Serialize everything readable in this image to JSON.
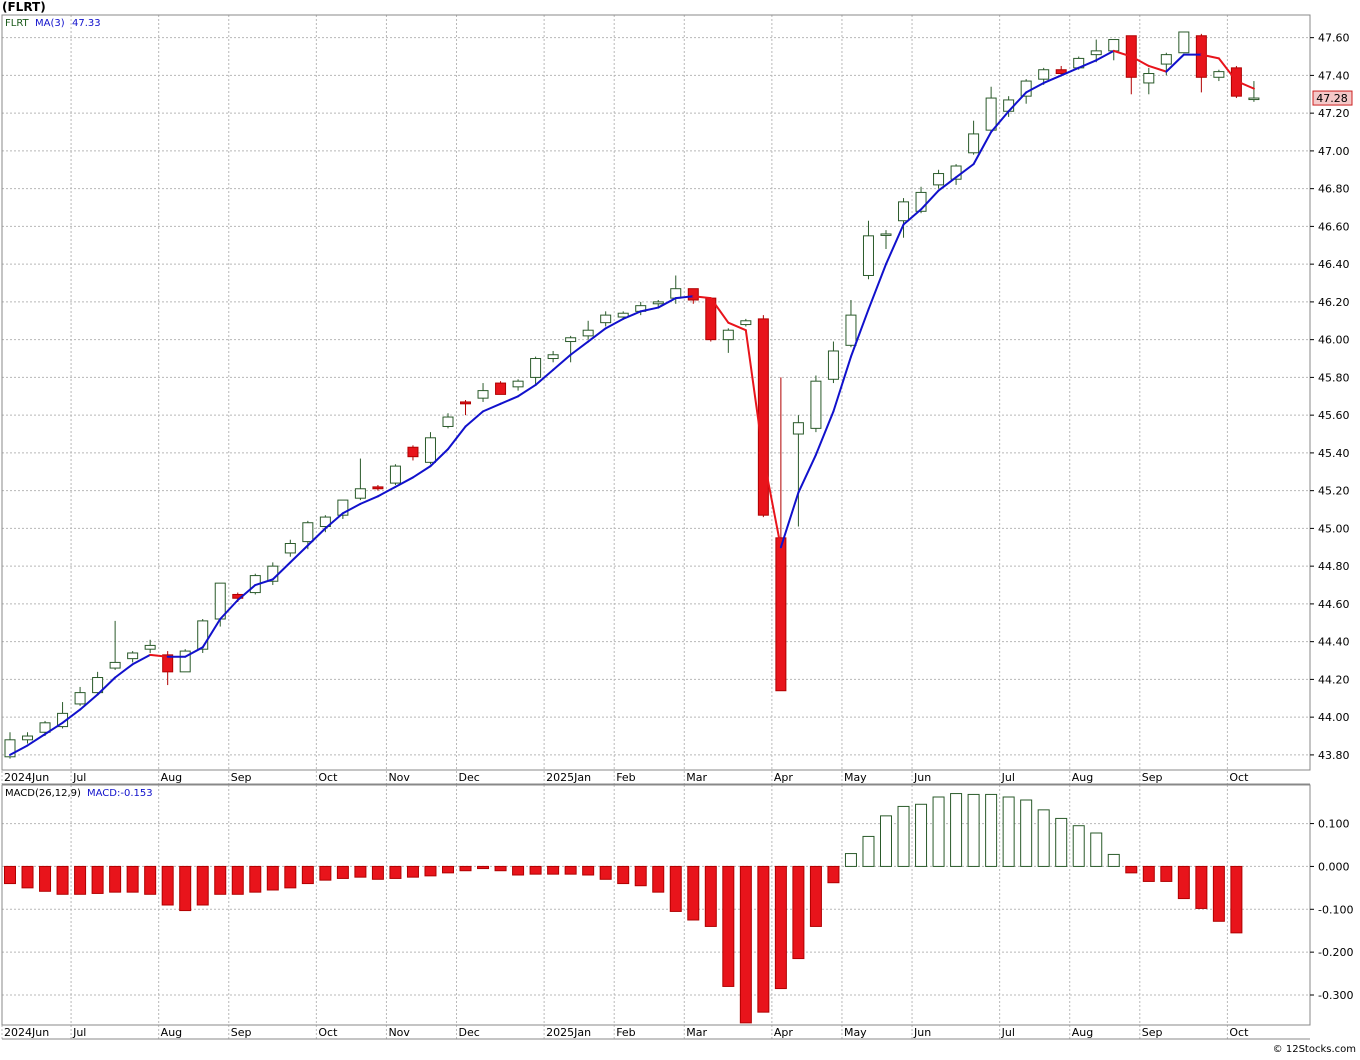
{
  "header": {
    "symbol_label": "(FLRT)"
  },
  "footer": {
    "credit": "© 12Stocks.com"
  },
  "colors": {
    "up_fill": "#ffffff",
    "up_stroke": "#2a5a2a",
    "down_fill": "#e8141b",
    "down_stroke": "#b00000",
    "ma_rising": "#1111cc",
    "ma_falling": "#e8141b",
    "grid": "#b8b8b8",
    "background": "#ffffff",
    "last_price_bg": "#f4c8c8",
    "last_price_border": "#cc2020"
  },
  "chart_data": [
    {
      "type": "candlestick",
      "panel": "price",
      "legend": {
        "symbol": "FLRT",
        "ma_label": "MA(3)",
        "ma_value": "47.33"
      },
      "last_price_label": "47.28",
      "ylim": [
        43.72,
        47.72
      ],
      "y_ticks": [
        "43.80",
        "44.00",
        "44.20",
        "44.40",
        "44.60",
        "44.80",
        "45.00",
        "45.20",
        "45.40",
        "45.60",
        "45.80",
        "46.00",
        "46.20",
        "46.40",
        "46.60",
        "46.80",
        "47.00",
        "47.20",
        "47.40",
        "47.60"
      ],
      "x_labels": [
        "2024Jun",
        "Jul",
        "Aug",
        "Sep",
        "Oct",
        "Nov",
        "Dec",
        "2025Jan",
        "Feb",
        "Mar",
        "Apr",
        "May",
        "Jun",
        "Jul",
        "Aug",
        "Sep",
        "Oct"
      ],
      "x_label_index": [
        0,
        4,
        9,
        13,
        18,
        22,
        26,
        31,
        35,
        39,
        44,
        48,
        52,
        57,
        61,
        65,
        70
      ],
      "candles": [
        {
          "o": 43.79,
          "h": 43.92,
          "l": 43.78,
          "c": 43.88
        },
        {
          "o": 43.88,
          "h": 43.92,
          "l": 43.86,
          "c": 43.9
        },
        {
          "o": 43.92,
          "h": 43.98,
          "l": 43.9,
          "c": 43.97
        },
        {
          "o": 43.95,
          "h": 44.08,
          "l": 43.94,
          "c": 44.02
        },
        {
          "o": 44.07,
          "h": 44.16,
          "l": 44.06,
          "c": 44.13
        },
        {
          "o": 44.13,
          "h": 44.24,
          "l": 44.12,
          "c": 44.21
        },
        {
          "o": 44.26,
          "h": 44.51,
          "l": 44.25,
          "c": 44.29
        },
        {
          "o": 44.31,
          "h": 44.35,
          "l": 44.29,
          "c": 44.34
        },
        {
          "o": 44.36,
          "h": 44.41,
          "l": 44.34,
          "c": 44.38
        },
        {
          "o": 44.33,
          "h": 44.35,
          "l": 44.17,
          "c": 44.24
        },
        {
          "o": 44.24,
          "h": 44.36,
          "l": 44.24,
          "c": 44.35
        },
        {
          "o": 44.36,
          "h": 44.52,
          "l": 44.34,
          "c": 44.51
        },
        {
          "o": 44.52,
          "h": 44.71,
          "l": 44.48,
          "c": 44.71
        },
        {
          "o": 44.65,
          "h": 44.66,
          "l": 44.61,
          "c": 44.63
        },
        {
          "o": 44.66,
          "h": 44.76,
          "l": 44.65,
          "c": 44.75
        },
        {
          "o": 44.72,
          "h": 44.82,
          "l": 44.7,
          "c": 44.8
        },
        {
          "o": 44.87,
          "h": 44.94,
          "l": 44.85,
          "c": 44.92
        },
        {
          "o": 44.93,
          "h": 45.04,
          "l": 44.89,
          "c": 45.03
        },
        {
          "o": 45.01,
          "h": 45.07,
          "l": 44.98,
          "c": 45.06
        },
        {
          "o": 45.07,
          "h": 45.15,
          "l": 45.05,
          "c": 45.15
        },
        {
          "o": 45.16,
          "h": 45.37,
          "l": 45.15,
          "c": 45.21
        },
        {
          "o": 45.22,
          "h": 45.23,
          "l": 45.2,
          "c": 45.21
        },
        {
          "o": 45.24,
          "h": 45.34,
          "l": 45.23,
          "c": 45.33
        },
        {
          "o": 45.43,
          "h": 45.44,
          "l": 45.36,
          "c": 45.38
        },
        {
          "o": 45.35,
          "h": 45.51,
          "l": 45.34,
          "c": 45.48
        },
        {
          "o": 45.54,
          "h": 45.61,
          "l": 45.53,
          "c": 45.59
        },
        {
          "o": 45.67,
          "h": 45.68,
          "l": 45.6,
          "c": 45.66
        },
        {
          "o": 45.69,
          "h": 45.77,
          "l": 45.67,
          "c": 45.73
        },
        {
          "o": 45.77,
          "h": 45.78,
          "l": 45.71,
          "c": 45.71
        },
        {
          "o": 45.75,
          "h": 45.79,
          "l": 45.73,
          "c": 45.78
        },
        {
          "o": 45.8,
          "h": 45.91,
          "l": 45.76,
          "c": 45.9
        },
        {
          "o": 45.9,
          "h": 45.94,
          "l": 45.88,
          "c": 45.92
        },
        {
          "o": 45.99,
          "h": 46.02,
          "l": 45.88,
          "c": 46.01
        },
        {
          "o": 46.02,
          "h": 46.1,
          "l": 46.0,
          "c": 46.05
        },
        {
          "o": 46.09,
          "h": 46.15,
          "l": 46.07,
          "c": 46.13
        },
        {
          "o": 46.12,
          "h": 46.15,
          "l": 46.11,
          "c": 46.14
        },
        {
          "o": 46.15,
          "h": 46.2,
          "l": 46.13,
          "c": 46.18
        },
        {
          "o": 46.19,
          "h": 46.21,
          "l": 46.17,
          "c": 46.2
        },
        {
          "o": 46.22,
          "h": 46.34,
          "l": 46.19,
          "c": 46.27
        },
        {
          "o": 46.27,
          "h": 46.27,
          "l": 46.19,
          "c": 46.21
        },
        {
          "o": 46.22,
          "h": 46.22,
          "l": 45.99,
          "c": 46.0
        },
        {
          "o": 46.0,
          "h": 46.06,
          "l": 45.93,
          "c": 46.05
        },
        {
          "o": 46.08,
          "h": 46.11,
          "l": 46.07,
          "c": 46.1
        },
        {
          "o": 46.11,
          "h": 46.13,
          "l": 45.06,
          "c": 45.07
        },
        {
          "o": 44.95,
          "h": 45.8,
          "l": 44.14,
          "c": 44.14
        },
        {
          "o": 45.5,
          "h": 45.6,
          "l": 45.01,
          "c": 45.56
        },
        {
          "o": 45.53,
          "h": 45.81,
          "l": 45.51,
          "c": 45.78
        },
        {
          "o": 45.79,
          "h": 45.99,
          "l": 45.77,
          "c": 45.94
        },
        {
          "o": 45.97,
          "h": 46.21,
          "l": 45.96,
          "c": 46.13
        },
        {
          "o": 46.34,
          "h": 46.63,
          "l": 46.32,
          "c": 46.55
        },
        {
          "o": 46.56,
          "h": 46.58,
          "l": 46.48,
          "c": 46.56
        },
        {
          "o": 46.63,
          "h": 46.75,
          "l": 46.54,
          "c": 46.73
        },
        {
          "o": 46.68,
          "h": 46.81,
          "l": 46.67,
          "c": 46.78
        },
        {
          "o": 46.82,
          "h": 46.9,
          "l": 46.8,
          "c": 46.88
        },
        {
          "o": 46.85,
          "h": 46.93,
          "l": 46.82,
          "c": 46.92
        },
        {
          "o": 46.99,
          "h": 47.16,
          "l": 46.98,
          "c": 47.09
        },
        {
          "o": 47.11,
          "h": 47.34,
          "l": 47.1,
          "c": 47.28
        },
        {
          "o": 47.21,
          "h": 47.29,
          "l": 47.18,
          "c": 47.27
        },
        {
          "o": 47.29,
          "h": 47.38,
          "l": 47.25,
          "c": 47.37
        },
        {
          "o": 47.38,
          "h": 47.44,
          "l": 47.35,
          "c": 47.43
        },
        {
          "o": 47.43,
          "h": 47.45,
          "l": 47.4,
          "c": 47.41
        },
        {
          "o": 47.44,
          "h": 47.5,
          "l": 47.43,
          "c": 47.49
        },
        {
          "o": 47.51,
          "h": 47.59,
          "l": 47.47,
          "c": 47.53
        },
        {
          "o": 47.53,
          "h": 47.59,
          "l": 47.48,
          "c": 47.59
        },
        {
          "o": 47.61,
          "h": 47.61,
          "l": 47.3,
          "c": 47.39
        },
        {
          "o": 47.36,
          "h": 47.44,
          "l": 47.3,
          "c": 47.41
        },
        {
          "o": 47.46,
          "h": 47.52,
          "l": 47.4,
          "c": 47.51
        },
        {
          "o": 47.52,
          "h": 47.63,
          "l": 47.52,
          "c": 47.63
        },
        {
          "o": 47.61,
          "h": 47.62,
          "l": 47.31,
          "c": 47.39
        },
        {
          "o": 47.39,
          "h": 47.43,
          "l": 47.37,
          "c": 47.42
        },
        {
          "o": 47.44,
          "h": 47.45,
          "l": 47.28,
          "c": 47.29
        },
        {
          "o": 47.28,
          "h": 47.37,
          "l": 47.26,
          "c": 47.28
        }
      ],
      "ma3": [
        43.8,
        43.85,
        43.91,
        43.97,
        44.04,
        44.12,
        44.21,
        44.28,
        44.33,
        44.32,
        44.32,
        44.37,
        44.52,
        44.62,
        44.7,
        44.73,
        44.82,
        44.91,
        45.0,
        45.08,
        45.13,
        45.17,
        45.22,
        45.27,
        45.33,
        45.42,
        45.54,
        45.62,
        45.66,
        45.7,
        45.76,
        45.84,
        45.92,
        45.99,
        46.06,
        46.11,
        46.15,
        46.17,
        46.22,
        46.23,
        46.22,
        46.09,
        46.05,
        45.38,
        44.9,
        45.19,
        45.39,
        45.62,
        45.91,
        46.16,
        46.4,
        46.61,
        46.69,
        46.79,
        46.86,
        46.93,
        47.1,
        47.21,
        47.31,
        47.36,
        47.4,
        47.44,
        47.48,
        47.53,
        47.5,
        47.45,
        47.42,
        47.51,
        47.51,
        47.49,
        47.37,
        47.33
      ]
    },
    {
      "type": "bar",
      "panel": "macd",
      "legend": {
        "label": "MACD(26,12,9)",
        "value_label": "MACD:-0.153"
      },
      "ylim": [
        -0.37,
        0.19
      ],
      "y_ticks": [
        "0.100",
        "0.000",
        "-0.100",
        "-0.200",
        "-0.300"
      ],
      "x_labels": [
        "2024Jun",
        "Jul",
        "Aug",
        "Sep",
        "Oct",
        "Nov",
        "Dec",
        "2025Jan",
        "Feb",
        "Mar",
        "Apr",
        "May",
        "Jun",
        "Jul",
        "Aug",
        "Sep",
        "Oct"
      ],
      "values": [
        -0.04,
        -0.05,
        -0.058,
        -0.065,
        -0.065,
        -0.063,
        -0.06,
        -0.06,
        -0.065,
        -0.09,
        -0.103,
        -0.09,
        -0.065,
        -0.065,
        -0.06,
        -0.055,
        -0.05,
        -0.04,
        -0.032,
        -0.028,
        -0.025,
        -0.03,
        -0.028,
        -0.025,
        -0.022,
        -0.015,
        -0.01,
        -0.005,
        -0.01,
        -0.02,
        -0.018,
        -0.018,
        -0.018,
        -0.02,
        -0.03,
        -0.04,
        -0.045,
        -0.06,
        -0.105,
        -0.125,
        -0.14,
        -0.28,
        -0.365,
        -0.34,
        -0.285,
        -0.215,
        -0.14,
        -0.038,
        0.03,
        0.07,
        0.118,
        0.14,
        0.145,
        0.162,
        0.17,
        0.168,
        0.168,
        0.162,
        0.155,
        0.132,
        0.112,
        0.095,
        0.078,
        0.028,
        -0.015,
        -0.035,
        -0.035,
        -0.075,
        -0.098,
        -0.128,
        -0.155
      ]
    }
  ]
}
